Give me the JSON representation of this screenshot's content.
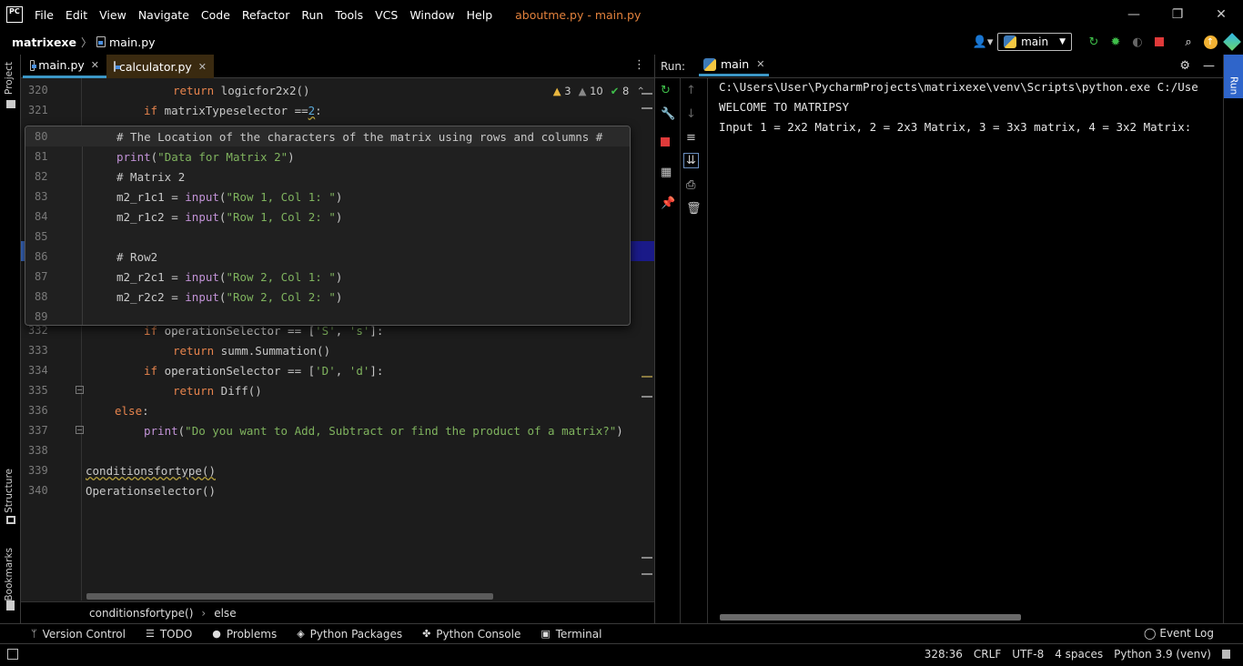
{
  "title_bar": {
    "app_icon": "PC",
    "menu": [
      "File",
      "Edit",
      "View",
      "Navigate",
      "Code",
      "Refactor",
      "Run",
      "Tools",
      "VCS",
      "Window",
      "Help"
    ],
    "window_title": "aboutme.py - main.py",
    "controls": {
      "minimize": "—",
      "restore": "❐",
      "close": "✕"
    }
  },
  "nav_bar": {
    "project": "matrixexe",
    "file": "main.py",
    "run_config": "main"
  },
  "left_stripe": {
    "project": "Project",
    "structure": "Structure",
    "bookmarks": "Bookmarks"
  },
  "editor": {
    "tabs": [
      {
        "label": "main.py",
        "active": true
      },
      {
        "label": "calculator.py",
        "active": false
      }
    ],
    "inspections": {
      "warnings": "3",
      "weak_warnings": "10",
      "ok": "8"
    },
    "lines": [
      {
        "num": "320",
        "html_key": "l320"
      },
      {
        "num": "321",
        "html_key": "l321"
      },
      {
        "num": "332",
        "html_key": "l332"
      },
      {
        "num": "333",
        "html_key": "l333"
      },
      {
        "num": "334",
        "html_key": "l334"
      },
      {
        "num": "335",
        "html_key": "l335"
      },
      {
        "num": "336",
        "html_key": "l336"
      },
      {
        "num": "337",
        "html_key": "l337"
      },
      {
        "num": "338",
        "html_key": "l338"
      },
      {
        "num": "339",
        "html_key": "l339"
      },
      {
        "num": "340",
        "html_key": "l340"
      }
    ],
    "code": {
      "l320_kw": "return",
      "l320_rest": " logicfor2x2()",
      "l321_kw": "if",
      "l321_a": " matrixTypeselector ==",
      "l321_num": "2",
      "l321_b": ":",
      "l332_kw": "if",
      "l332_a": " operationSelector == [",
      "l332_s1": "'S'",
      "l332_b": ", ",
      "l332_s2": "'s'",
      "l332_c": "]:",
      "l333_kw": "return",
      "l333_rest": " summ.Summation()",
      "l334_kw": "if",
      "l334_a": " operationSelector == [",
      "l334_s1": "'D'",
      "l334_b": ", ",
      "l334_s2": "'d'",
      "l334_c": "]:",
      "l335_kw": "return",
      "l335_rest": " Diff()",
      "l336_kw": "else",
      "l336_rest": ":",
      "l337_bi": "print",
      "l337_a": "(",
      "l337_str": "\"Do you want to Add, Subtract or find the product of a matrix?\"",
      "l337_b": ")",
      "l339": "conditionsfortype()",
      "l340": "Operationselector()"
    },
    "breadcrumb": {
      "fn": "conditionsfortype()",
      "sep": "›",
      "branch": "else"
    }
  },
  "peek": {
    "line_numbers": [
      "80",
      "81",
      "82",
      "83",
      "84",
      "85",
      "86",
      "87",
      "88",
      "89"
    ],
    "l80": "# The Location of the characters of the matrix using rows and columns #",
    "l81_bi": "print",
    "l81_a": "(",
    "l81_str": "\"Data for Matrix 2\"",
    "l81_b": ")",
    "l82": "# Matrix 2",
    "l83_a": "m2_r1c1 = ",
    "l83_bi": "input",
    "l83_b": "(",
    "l83_str": "\"Row 1, Col 1: \"",
    "l83_c": ")",
    "l84_a": "m2_r1c2 = ",
    "l84_bi": "input",
    "l84_b": "(",
    "l84_str": "\"Row 1, Col 2: \"",
    "l84_c": ")",
    "l86": "# Row2",
    "l87_a": "m2_r2c1 = ",
    "l87_bi": "input",
    "l87_b": "(",
    "l87_str": "\"Row 2, Col 1: \"",
    "l87_c": ")",
    "l88_a": "m2_r2c2 = ",
    "l88_bi": "input",
    "l88_b": "(",
    "l88_str": "\"Row 2, Col 2: \"",
    "l88_c": ")"
  },
  "run_panel": {
    "label": "Run:",
    "tab": "main",
    "output": [
      "C:\\Users\\User\\PycharmProjects\\matrixexe\\venv\\Scripts\\python.exe C:/Use",
      "WELCOME TO MATRIPSY",
      "Input 1 = 2x2 Matrix, 2 = 2x3 Matrix, 3 = 3x3 matrix, 4 = 3x2 Matrix:"
    ]
  },
  "right_stripe": {
    "run": "Run"
  },
  "bottom_tools": [
    "Version Control",
    "TODO",
    "Problems",
    "Python Packages",
    "Python Console",
    "Terminal"
  ],
  "event_log": "Event Log",
  "status_bar": {
    "position": "328:36",
    "line_sep": "CRLF",
    "encoding": "UTF-8",
    "indent": "4 spaces",
    "interpreter": "Python 3.9 (venv)"
  },
  "colors": {
    "accent": "#3c97c6",
    "run_tab": "#2f65ca",
    "keyword": "#e7844d",
    "string": "#7fb35e",
    "comment": "#7a9ec3"
  }
}
